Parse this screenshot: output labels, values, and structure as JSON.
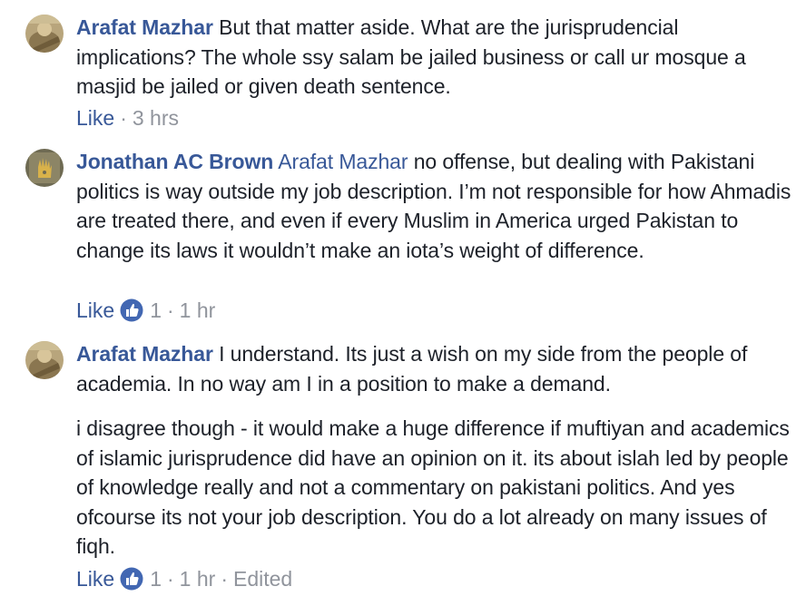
{
  "comments": [
    {
      "author": "Arafat Mazhar",
      "paragraphs": [
        "But that matter aside. What are the jurisprudencial implications? The whole ssy salam be jailed business or call ur mosque a masjid be jailed or given death sentence."
      ],
      "like_label": "Like",
      "separator": "·",
      "time": "3 hrs"
    },
    {
      "author": "Jonathan AC Brown",
      "mention": "Arafat Mazhar",
      "paragraphs": [
        " no offense, but dealing with Pakistani politics is way outside my job description. I’m not responsible for how Ahmadis are treated there, and even if every Muslim in America urged Pakistan to change its laws it wouldn’t make an iota’s weight of difference."
      ],
      "like_label": "Like",
      "separator": "·",
      "reaction_count": "1",
      "time": "1 hr"
    },
    {
      "author": "Arafat Mazhar",
      "paragraphs": [
        "I understand. Its just a wish on my side from the people of academia. In no way am I in a position to make a demand.",
        "i disagree though - it would make a huge difference if muftiyan and academics of islamic jurisprudence did have an opinion on it. its about islah led by people of knowledge really and not a commentary on pakistani politics. And yes ofcourse its not your job description. You do a lot already on many issues of fiqh."
      ],
      "like_label": "Like",
      "separator": "·",
      "reaction_count": "1",
      "time": "1 hr",
      "edited_label": "Edited"
    }
  ],
  "colors": {
    "link": "#385898",
    "text": "#1d2129",
    "meta": "#90949c",
    "like_blue": "#4267b2"
  },
  "icons": {
    "reaction": "thumbs-up-icon"
  }
}
